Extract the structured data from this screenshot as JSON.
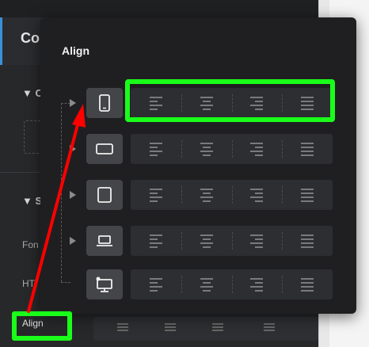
{
  "background": {
    "title": "Co",
    "section1_label": "▼ C",
    "section2_label": "▼ S",
    "font_label": "Fon",
    "html_label": "HT",
    "align_label": "Align"
  },
  "popover": {
    "title": "Align",
    "devices": [
      {
        "name": "mobile-portrait",
        "icon": "phone-portrait-icon"
      },
      {
        "name": "mobile-landscape",
        "icon": "phone-landscape-icon"
      },
      {
        "name": "tablet",
        "icon": "tablet-icon"
      },
      {
        "name": "laptop",
        "icon": "laptop-icon"
      },
      {
        "name": "desktop",
        "icon": "desktop-icon"
      }
    ],
    "align_options": [
      "left",
      "center",
      "right",
      "justify"
    ]
  },
  "colors": {
    "highlight": "#1aff1a",
    "arrow": "#ff0000",
    "popover_bg": "#1f1f21",
    "accent": "#3a8fd9"
  }
}
